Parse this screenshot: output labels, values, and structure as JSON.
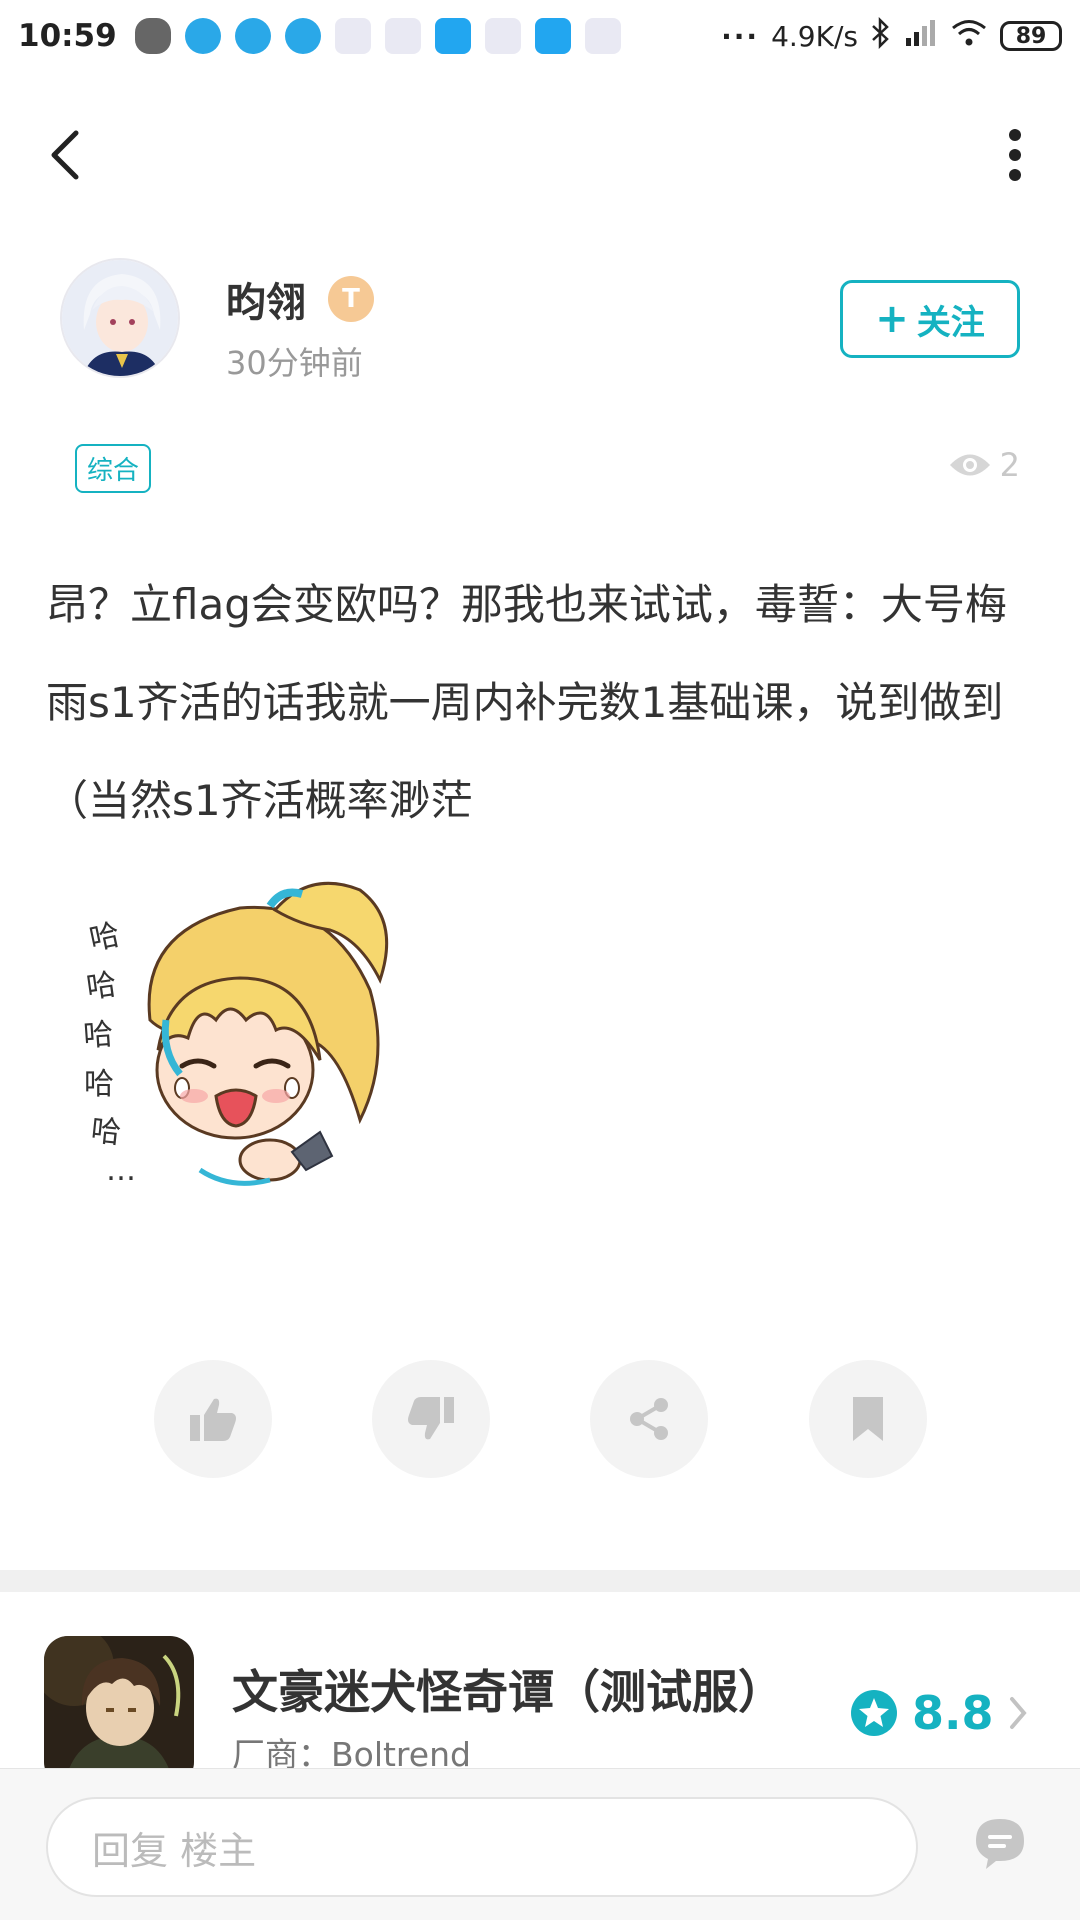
{
  "status_bar": {
    "time": "10:59",
    "net_speed": "4.9K/s",
    "battery": "89"
  },
  "author": {
    "name": "昀翎",
    "level_badge": "T",
    "time_ago": "30分钟前",
    "follow_label": "关注"
  },
  "post": {
    "tag": "综合",
    "views": "2",
    "text": "昂？立flag会变欧吗？那我也来试试，毒誓：大号梅雨s1齐活的话我就一周内补完数1基础课，说到做到（当然s1齐活概率渺茫",
    "sticker_text": "哈哈哈哈哈..."
  },
  "actions": {
    "like": "thumbs-up-icon",
    "dislike": "thumbs-down-icon",
    "share": "share-icon",
    "bookmark": "bookmark-icon"
  },
  "game": {
    "title": "文豪迷犬怪奇谭（测试服）",
    "vendor": "厂商：Boltrend",
    "rating": "8.8"
  },
  "reply": {
    "placeholder": "回复  楼主"
  },
  "colors": {
    "accent": "#15b2c1",
    "muted": "#999999"
  }
}
